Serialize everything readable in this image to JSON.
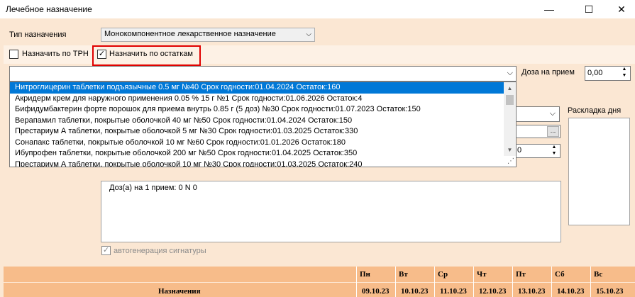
{
  "window": {
    "title": "Лечебное назначение",
    "minimize": "—",
    "maximize": "☐",
    "close": "✕"
  },
  "form": {
    "type_label": "Тип назначения",
    "type_value": "Монокомпонентное лекарственное назначение",
    "by_trn_label": "Назначить по ТРН",
    "by_stock_label": "Назначить по остаткам",
    "by_stock_checked": "✓",
    "dose_label": "Доза на прием",
    "dose_value": "0,00",
    "small_value": "0",
    "day_layout_label": "Раскладка дня",
    "browse": "...",
    "signature_text": "Доз(а) на 1 прием: 0   N 0",
    "autogen_label": "автогенерация сигнатуры",
    "autogen_checked": "✓"
  },
  "dropdown": {
    "items": [
      "Нитроглицерин таблетки подъязычные 0.5 мг №40 Срок годности:01.04.2024 Остаток:160",
      "Акридерм крем для наружного применения 0.05 % 15 г №1 Срок годности:01.06.2026 Остаток:4",
      "Бифидумбактерин форте порошок для приема внутрь 0.85 г (5 доз) №30 Срок годности:01.07.2023 Остаток:150",
      "Верапамил таблетки, покрытые оболочкой 40 мг №50 Срок годности:01.04.2024 Остаток:150",
      "Престариум А таблетки, покрытые оболочкой 5 мг №30 Срок годности:01.03.2025 Остаток:330",
      "Сонапакс таблетки, покрытые оболочкой 10 мг №60 Срок годности:01.01.2026 Остаток:180",
      "Ибупрофен таблетки, покрытые оболочкой 200 мг №50 Срок годности:01.04.2025 Остаток:350",
      "Престариум А таблетки, покрытые оболочкой 10 мг №30 Срок годности:01.03.2025 Остаток:240"
    ]
  },
  "table": {
    "row_header": "Назначения",
    "days": [
      "Пн",
      "Вт",
      "Ср",
      "Чт",
      "Пт",
      "Сб",
      "Вс"
    ],
    "dates": [
      "09.10.23",
      "10.10.23",
      "11.10.23",
      "12.10.23",
      "13.10.23",
      "14.10.23",
      "15.10.23"
    ]
  },
  "colors": {
    "background": "#fbe7d3",
    "selection": "#0078d7",
    "header": "#f7bc8a",
    "highlight": "#e00000"
  }
}
